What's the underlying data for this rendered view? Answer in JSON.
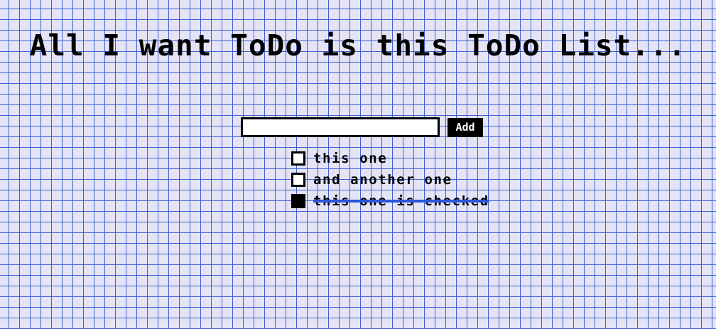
{
  "page": {
    "title": "All I want ToDo is this ToDo List..."
  },
  "form": {
    "input_value": "",
    "input_placeholder": "",
    "add_label": "Add"
  },
  "todos": [
    {
      "text": "this one",
      "checked": false
    },
    {
      "text": "and another one",
      "checked": false
    },
    {
      "text": "this one is checked",
      "checked": true
    }
  ],
  "colors": {
    "background": "#e4e4f6",
    "grid_line": "#3f5fd2",
    "strikethrough": "#2d55d8"
  }
}
